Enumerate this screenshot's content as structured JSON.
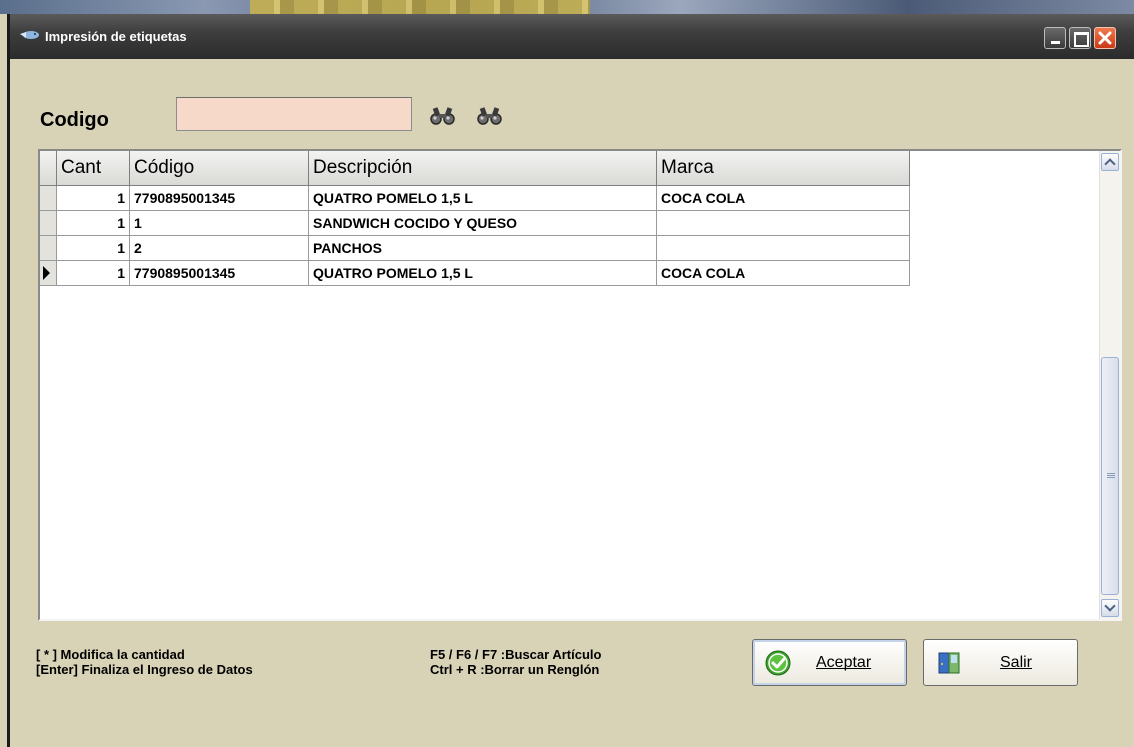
{
  "window": {
    "title": "Impresión de etiquetas",
    "controls": [
      "minimize",
      "maximize",
      "close"
    ]
  },
  "search": {
    "label": "Codigo",
    "value": "",
    "search_icon": "binoculars-icon",
    "search_icon_2": "binoculars-icon"
  },
  "grid": {
    "columns": [
      "Cant",
      "Código",
      "Descripción",
      "Marca"
    ],
    "rows": [
      {
        "cant": "1",
        "codigo": "7790895001345",
        "descripcion": "QUATRO POMELO 1,5 L",
        "marca": "COCA COLA"
      },
      {
        "cant": "1",
        "codigo": "1",
        "descripcion": "SANDWICH COCIDO Y QUESO",
        "marca": ""
      },
      {
        "cant": "1",
        "codigo": "2",
        "descripcion": "PANCHOS",
        "marca": ""
      },
      {
        "cant": "1",
        "codigo": "7790895001345",
        "descripcion": "QUATRO POMELO 1,5 L",
        "marca": "COCA COLA"
      }
    ],
    "current_row": 4
  },
  "help": {
    "line1": "[ * ]  Modifica la cantidad",
    "line2": "[Enter]  Finaliza el Ingreso de Datos",
    "line3": "F5 / F6 / F7 :Buscar Artículo",
    "line4": "Ctrl + R :Borrar un Renglón"
  },
  "buttons": {
    "aceptar": "Aceptar",
    "salir": "Salir"
  },
  "colors": {
    "window_bg": "#d8d2b6",
    "input_bg": "#f6d9c9",
    "titlebar": "#3e3e3e",
    "close_button": "#d9481f"
  }
}
